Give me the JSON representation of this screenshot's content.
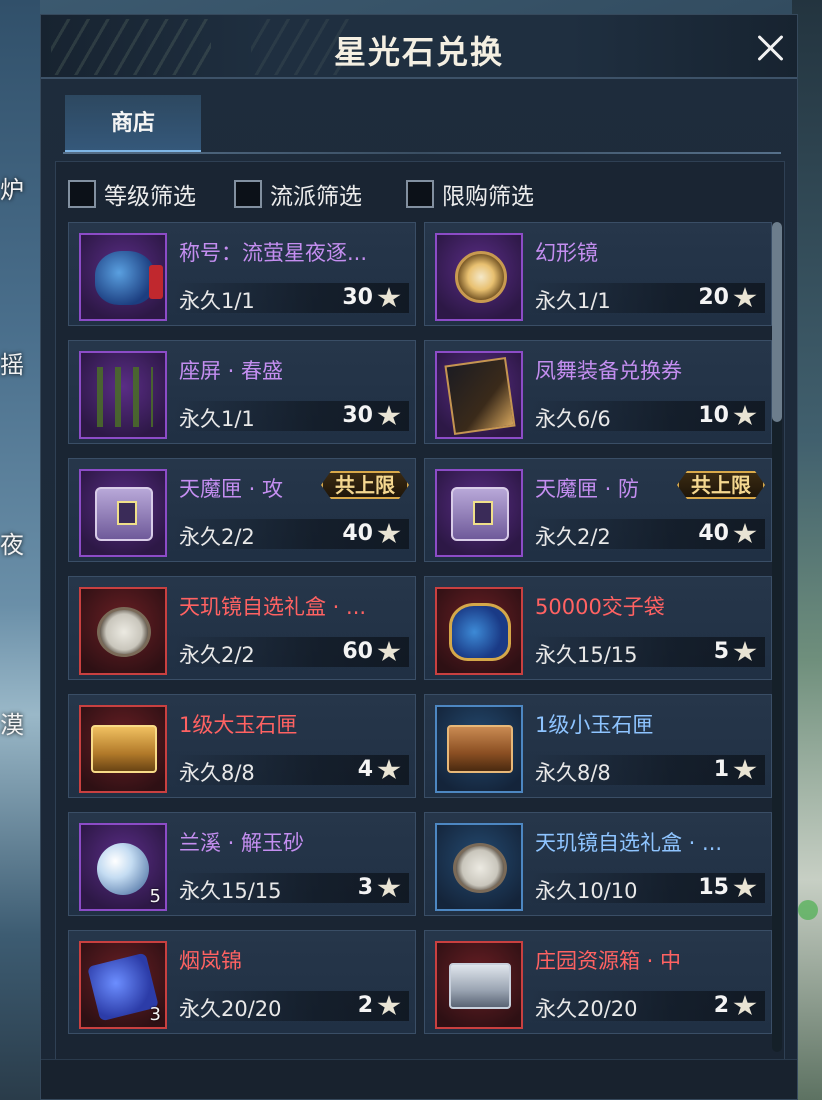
{
  "window": {
    "title": "星光石兑换",
    "close_icon": "close-icon"
  },
  "background": {
    "left_labels": [
      "炉",
      "摇",
      "夜",
      "漠"
    ]
  },
  "tabs": [
    {
      "label": "商店",
      "active": true
    }
  ],
  "filters": [
    {
      "label": "等级筛选",
      "checked": false
    },
    {
      "label": "流派筛选",
      "checked": false
    },
    {
      "label": "限购筛选",
      "checked": false
    }
  ],
  "currency_icon": "star-shard-icon",
  "items": [
    {
      "name": "称号：流萤星夜逐...",
      "rarity": "purple",
      "art": "pouch",
      "limit": "永久1/1",
      "price": "30",
      "qty": "",
      "badge": ""
    },
    {
      "name": "幻形镜",
      "rarity": "purple",
      "art": "mirror",
      "limit": "永久1/1",
      "price": "20",
      "qty": "",
      "badge": ""
    },
    {
      "name": "座屏 · 春盛",
      "rarity": "purple",
      "art": "screen",
      "limit": "永久1/1",
      "price": "30",
      "qty": "",
      "badge": ""
    },
    {
      "name": "凤舞装备兑换券",
      "rarity": "purple",
      "art": "ticket",
      "limit": "永久6/6",
      "price": "10",
      "qty": "",
      "badge": ""
    },
    {
      "name": "天魔匣 · 攻",
      "rarity": "purple",
      "art": "chest",
      "limit": "永久2/2",
      "price": "40",
      "qty": "",
      "badge": "共上限"
    },
    {
      "name": "天魔匣 · 防",
      "rarity": "purple",
      "art": "chest",
      "limit": "永久2/2",
      "price": "40",
      "qty": "",
      "badge": "共上限"
    },
    {
      "name": "天玑镜自选礼盒 · ...",
      "rarity": "red",
      "art": "dish",
      "limit": "永久2/2",
      "price": "60",
      "qty": "",
      "badge": ""
    },
    {
      "name": "50000交子袋",
      "rarity": "red",
      "art": "bag",
      "limit": "永久15/15",
      "price": "5",
      "qty": "",
      "badge": ""
    },
    {
      "name": "1级大玉石匣",
      "rarity": "red",
      "art": "gold",
      "limit": "永久8/8",
      "price": "4",
      "qty": "",
      "badge": ""
    },
    {
      "name": "1级小玉石匣",
      "rarity": "blue",
      "art": "gold brown",
      "limit": "永久8/8",
      "price": "1",
      "qty": "",
      "badge": ""
    },
    {
      "name": "兰溪 · 解玉砂",
      "rarity": "purple",
      "art": "orb",
      "limit": "永久15/15",
      "price": "3",
      "qty": "5",
      "badge": ""
    },
    {
      "name": "天玑镜自选礼盒 · ...",
      "rarity": "blue",
      "art": "dish",
      "limit": "永久10/10",
      "price": "15",
      "qty": "",
      "badge": ""
    },
    {
      "name": "烟岚锦",
      "rarity": "red",
      "art": "brocade",
      "limit": "永久20/20",
      "price": "2",
      "qty": "3",
      "badge": ""
    },
    {
      "name": "庄园资源箱 · 中",
      "rarity": "red",
      "art": "silver",
      "limit": "永久20/20",
      "price": "2",
      "qty": "",
      "badge": ""
    }
  ],
  "colors": {
    "purple": "#c48ef0",
    "red": "#ff6262",
    "blue": "#8ec4ff",
    "badge_gold": "#d9a94a"
  }
}
